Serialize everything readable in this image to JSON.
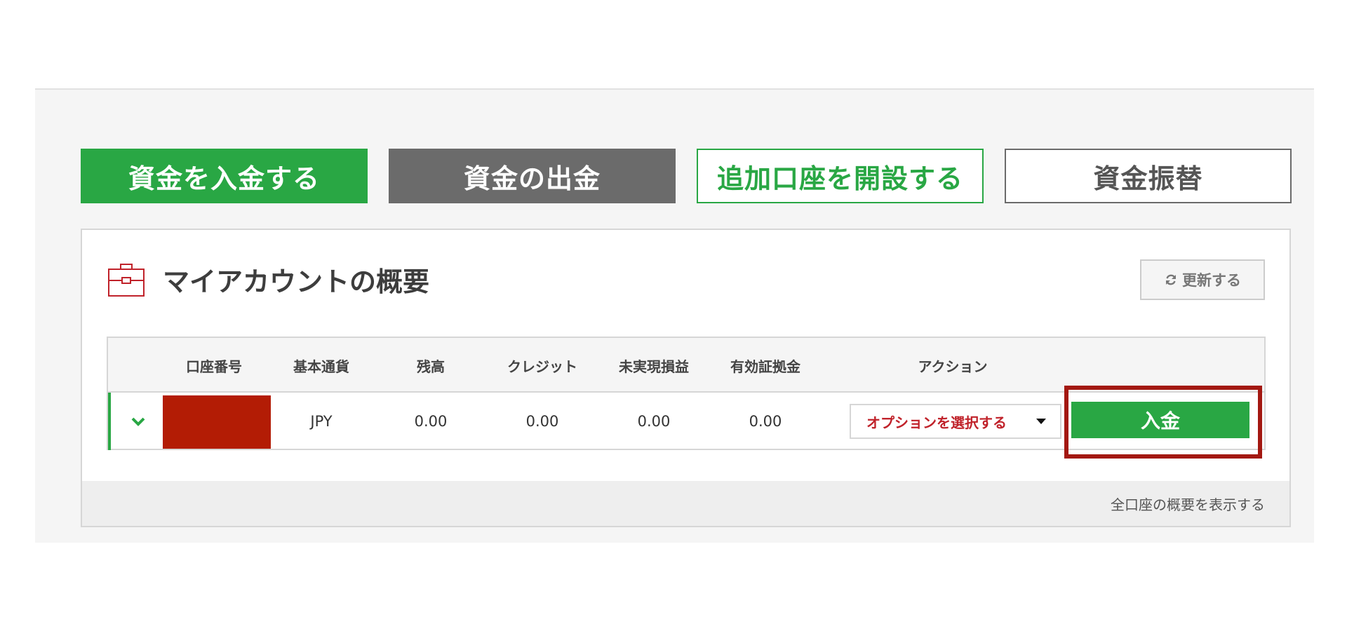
{
  "actions": {
    "deposit_funds": "資金を入金する",
    "withdraw_funds": "資金の出金",
    "open_additional_account": "追加口座を開設する",
    "transfer_funds": "資金振替"
  },
  "panel": {
    "title": "マイアカウントの概要",
    "refresh_label": "更新する",
    "footer_link": "全口座の概要を表示する"
  },
  "table": {
    "headers": [
      "口座番号",
      "基本通貨",
      "残高",
      "クレジット",
      "未実現損益",
      "有効証拠金",
      "アクション"
    ],
    "rows": [
      {
        "account_number": "",
        "currency": "JPY",
        "balance": "0.00",
        "credit": "0.00",
        "unrealized_pl": "0.00",
        "equity": "0.00",
        "action_select": "オプションを選択する",
        "deposit_button": "入金"
      }
    ]
  },
  "colors": {
    "accent_green": "#29a744",
    "gray_button": "#6b6b6b",
    "alert_red": "#c0222a",
    "highlight_red": "#a31811",
    "redaction": "#b31c05"
  },
  "icons": {
    "briefcase": "briefcase-icon",
    "refresh": "refresh-icon",
    "expand": "chevron-down-icon",
    "select_caret": "caret-down-icon"
  }
}
